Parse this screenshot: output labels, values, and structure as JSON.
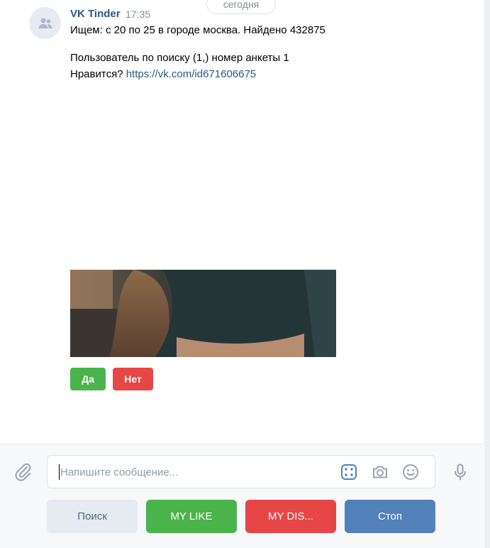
{
  "date_separator": "сегодня",
  "message": {
    "author": "VK Tinder",
    "time": "17:35",
    "line1": "Ищем: с 20 по 25 в городе москва. Найдено 432875",
    "line2": "Пользователь по поиску (1,) номер анкеты 1",
    "line3_prefix": "Нравится? ",
    "link": "https://vk.com/id671606675"
  },
  "inline_keyboard": {
    "yes_label": "Да",
    "no_label": "Нет",
    "yes_color": "#4bb34b",
    "no_color": "#e64646"
  },
  "composer": {
    "placeholder": "Напишите сообщение...",
    "value": ""
  },
  "bot_keyboard": {
    "search_label": "Поиск",
    "like_label": "MY LIKE",
    "dislike_label": "MY DIS...",
    "stop_label": "Стоп"
  },
  "icons": {
    "avatar": "group-icon",
    "attach": "paperclip-icon",
    "keyboard": "bot-keyboard-icon",
    "camera": "camera-icon",
    "emoji": "smile-icon",
    "mic": "microphone-icon"
  },
  "colors": {
    "link": "#2a5885",
    "primary": "#5181b8",
    "positive": "#4bb34b",
    "negative": "#e64646"
  }
}
